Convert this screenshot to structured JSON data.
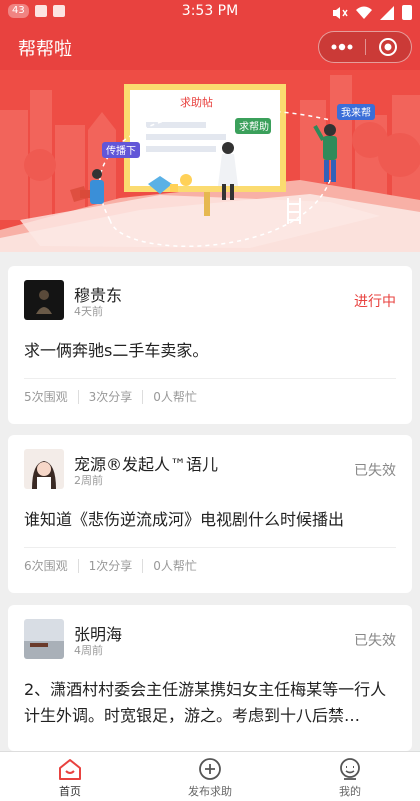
{
  "status_bar": {
    "notification_count": "43",
    "time": "3:53 PM"
  },
  "app": {
    "title": "帮帮啦"
  },
  "banner": {
    "board_title": "求助帖",
    "bubble_help": "求帮助",
    "bubble_spread": "传播下",
    "bubble_ill_help": "我来帮"
  },
  "posts": [
    {
      "user": "穆贵东",
      "time": "4天前",
      "status": "进行中",
      "status_type": "active",
      "content": "求一俩奔驰s二手车卖家。",
      "views": "5次围观",
      "shares": "3次分享",
      "helpers": "0人帮忙"
    },
    {
      "user": "宠源®发起人™语儿",
      "time": "2周前",
      "status": "已失效",
      "status_type": "expired",
      "content": "谁知道《悲伤逆流成河》电视剧什么时候播出",
      "views": "6次围观",
      "shares": "1次分享",
      "helpers": "0人帮忙"
    },
    {
      "user": "张明海",
      "time": "4周前",
      "status": "已失效",
      "status_type": "expired",
      "content": "2、潇酒村村委会主任游某携妇女主任梅某等一行人计生外调。时宽银足，游之。考虑到十八后禁…"
    }
  ],
  "tabbar": {
    "home": "首页",
    "publish": "发布求助",
    "mine": "我的"
  }
}
